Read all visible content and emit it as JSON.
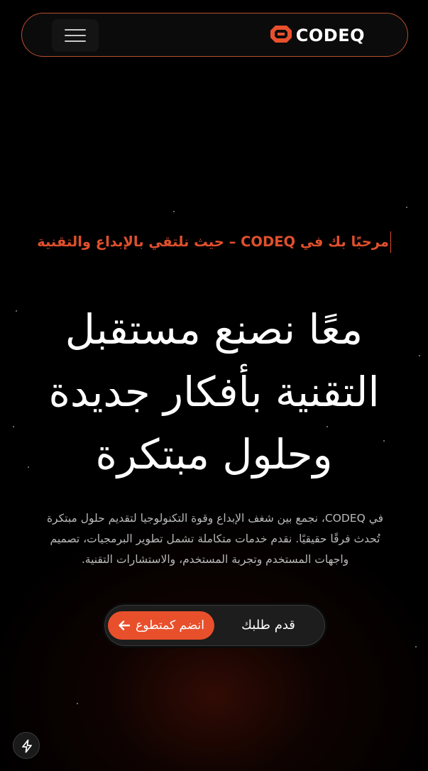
{
  "header": {
    "menu_icon": "hamburger-menu-icon",
    "logo_icon": "codeq-logo-icon",
    "logo_text": "CODEQ",
    "accent_color": "#e8502c"
  },
  "hero": {
    "tagline": "مرحبًا بك في CODEQ – حيث نلتقي بالإبداع والتقنية",
    "headline_lines": [
      "معًا نصنع مستقبل",
      "التقنية بأفكار جديدة",
      "وحلول مبتكرة"
    ],
    "description_lines": [
      "في CODEQ، نجمع بين شغف الإبداع وقوة التكنولوجيا لتقديم حلول مبتكرة",
      "تُحدث فرقًا حقيقيًا. نقدم خدمات متكاملة تشمل تطوير البرمجيات، تصميم",
      "واجهات المستخدم وتجربة المستخدم، والاستشارات التقنية."
    ]
  },
  "cta": {
    "join_label": "انضم كمتطوع",
    "join_icon": "arrow-left-icon",
    "request_label": "قدم طلبك"
  },
  "floating": {
    "bolt_icon": "lightning-bolt-icon"
  }
}
